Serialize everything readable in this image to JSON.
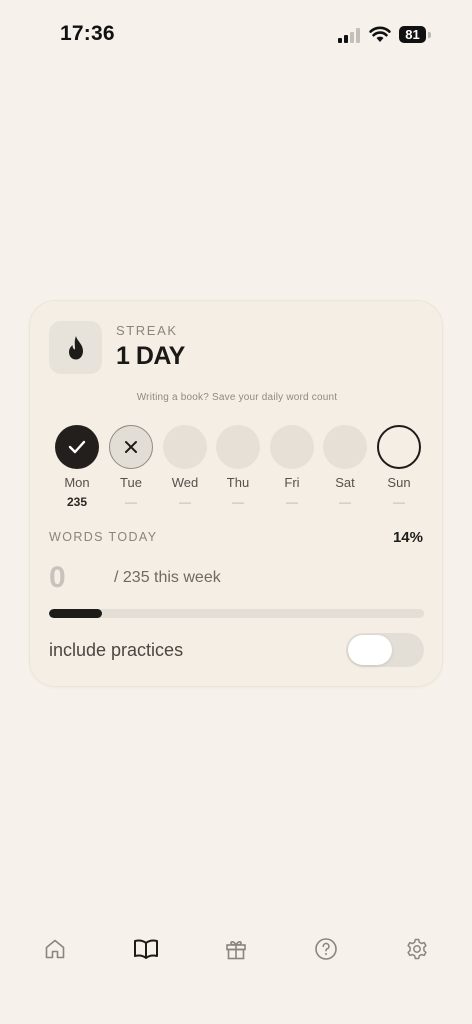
{
  "status_bar": {
    "time": "17:36",
    "battery": "81"
  },
  "card": {
    "streak_label": "STREAK",
    "streak_value": "1 DAY",
    "hint": "Writing a book? Save your daily word count",
    "days": [
      {
        "name": "Mon",
        "count": "235",
        "state": "done"
      },
      {
        "name": "Tue",
        "count": "—",
        "state": "missed"
      },
      {
        "name": "Wed",
        "count": "—",
        "state": "future"
      },
      {
        "name": "Thu",
        "count": "—",
        "state": "future"
      },
      {
        "name": "Fri",
        "count": "—",
        "state": "future"
      },
      {
        "name": "Sat",
        "count": "—",
        "state": "future"
      },
      {
        "name": "Sun",
        "count": "—",
        "state": "today"
      }
    ],
    "words_today_label": "WORDS TODAY",
    "percent": "14%",
    "words_today": "0",
    "week_text": "/ 235 this week",
    "progress": 0.14,
    "include_label": "include practices",
    "include_on": false
  },
  "tabbar": {
    "tabs": [
      {
        "icon": "home-icon"
      },
      {
        "icon": "book-icon",
        "active": true
      },
      {
        "icon": "gift-icon"
      },
      {
        "icon": "help-icon"
      },
      {
        "icon": "gear-icon"
      }
    ]
  },
  "colors": {
    "background": "#f6f1ea",
    "card": "#f4eee5",
    "accent": "#1e1c19",
    "muted": "#e6e0d7"
  }
}
